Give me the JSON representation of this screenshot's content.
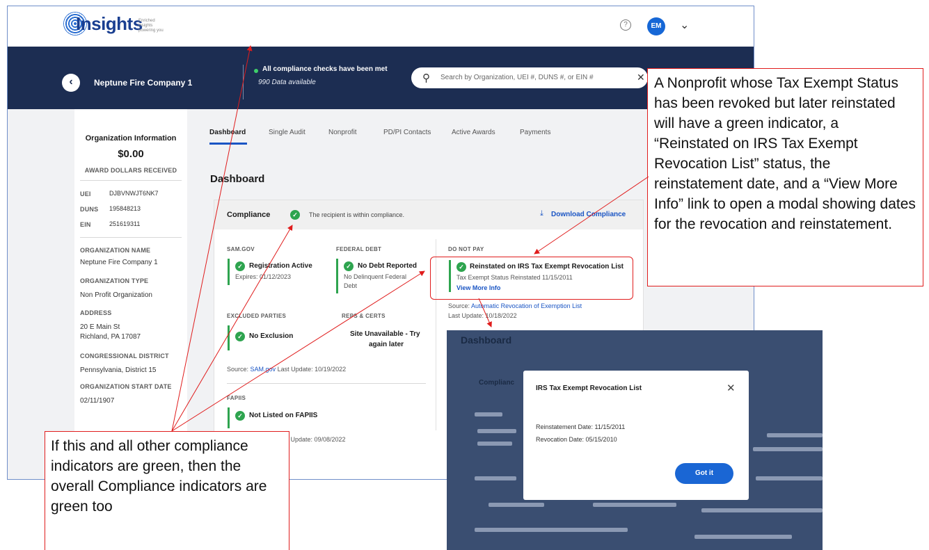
{
  "app": {
    "logo_small": "Insights",
    "logo_word": "Insights",
    "logo_tagline": "Enriched insights powering you"
  },
  "header": {
    "help_icon": "?",
    "avatar_initials": "EM",
    "menu_icon": "chevron-down"
  },
  "nav": {
    "org_name": "Neptune Fire Company 1",
    "status_text": "All compliance checks have been met",
    "status_sub": "990 Data available",
    "search_placeholder": "Search by Organization, UEI #, DUNS #, or EIN #"
  },
  "org_info": {
    "title": "Organization Information",
    "amount": "$0.00",
    "amount_label": "AWARD DOLLARS RECEIVED",
    "ids": [
      {
        "label": "UEI",
        "value": "DJBVNWJT6NK7"
      },
      {
        "label": "DUNS",
        "value": "195848213"
      },
      {
        "label": "EIN",
        "value": "251619311"
      }
    ],
    "fields": [
      {
        "label": "ORGANIZATION NAME",
        "value": "Neptune Fire Company 1"
      },
      {
        "label": "ORGANIZATION TYPE",
        "value": "Non Profit Organization"
      },
      {
        "label": "ADDRESS",
        "value": "20 E Main St",
        "value2": "Richland, PA 17087"
      },
      {
        "label": "CONGRESSIONAL DISTRICT",
        "value": "Pennsylvania, District 15"
      },
      {
        "label": "ORGANIZATION START DATE",
        "value": "02/11/1907"
      }
    ]
  },
  "tabs": [
    "Dashboard",
    "Single Audit",
    "Nonprofit",
    "PD/PI Contacts",
    "Active Awards",
    "Payments"
  ],
  "dashboard": {
    "title": "Dashboard",
    "compliance_label": "Compliance",
    "compliance_status": "The recipient is within compliance.",
    "download_label": "Download Compliance",
    "sam": {
      "label": "SAM.GOV",
      "title": "Registration Active",
      "sub": "Expires: 01/12/2023"
    },
    "debt": {
      "label": "FEDERAL DEBT",
      "title": "No Debt Reported",
      "sub1": "No Delinquent Federal",
      "sub2": "Debt"
    },
    "dnp": {
      "label": "DO NOT PAY",
      "title": "Reinstated on IRS Tax Exempt Revocation List",
      "sub": "Tax Exempt Status Reinstated 11/15/2011",
      "link": "View More Info",
      "source_prefix": "Source:",
      "source_link": "Automatic Revocation of Exemption List",
      "last_update": "Last Update: 10/18/2022"
    },
    "excluded": {
      "label": "EXCLUDED PARTIES",
      "title": "No Exclusion"
    },
    "reps": {
      "label": "REPS & CERTS",
      "title1": "Site Unavailable - Try",
      "title2": "again later"
    },
    "sam_source_prefix": "Source:",
    "sam_source_link": "SAM.gov",
    "sam_source_update": "Last Update: 10/19/2022",
    "fapiis": {
      "label": "FAPIIS",
      "title": "Not Listed on FAPIIS",
      "update": "st Update: 09/08/2022"
    }
  },
  "modal_shot": {
    "dash_title": "Dashboard",
    "compliance_fragment": "Complianc",
    "modal_title": "IRS Tax Exempt Revocation List",
    "reinstatement": "Reinstatement Date: 11/15/2011",
    "revocation": "Revocation Date: 05/15/2010",
    "button": "Got it"
  },
  "annotations": {
    "right": "A Nonprofit whose Tax Exempt Status has been revoked but later reinstated will have a green indicator, a “Reinstated on IRS Tax Exempt Revocation List” status, the reinstatement date, and a “View More Info” link to open a modal showing dates for the revocation and reinstatement.",
    "left": "If this and all other compliance indicators are green, then the overall Compliance indicators are green too"
  },
  "colors": {
    "navy": "#1c2d52",
    "green": "#2ea44f",
    "link_blue": "#1a55c4",
    "annotation_red": "#e01c1c"
  }
}
